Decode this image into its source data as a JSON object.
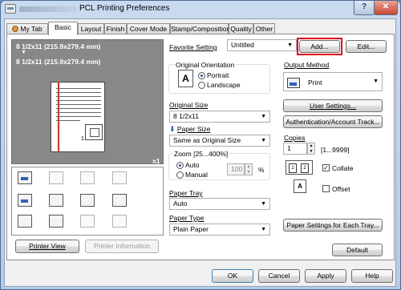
{
  "window": {
    "title": "PCL Printing Preferences",
    "help_btn": "?",
    "close_btn": "✕"
  },
  "tabs": [
    "My Tab",
    "Basic",
    "Layout",
    "Finish",
    "Cover Mode",
    "Stamp/Composition",
    "Quality",
    "Other"
  ],
  "favorite": {
    "label": "Favorite Setting",
    "value": "Untitled",
    "add": "Add...",
    "edit": "Edit..."
  },
  "preview": {
    "line1": "8 1/2x11 (215.9x279.4 mm)",
    "arrow": "▼",
    "line2": "8 1/2x11 (215.9x279.4 mm)",
    "zoom": "x1",
    "page_number": "1",
    "printer_view": "Printer View",
    "printer_info": "Printer Information"
  },
  "orientation": {
    "label": "Original Orientation",
    "icon_letter": "A",
    "portrait": "Portrait",
    "landscape": "Landscape",
    "selected": "Portrait"
  },
  "original_size": {
    "label": "Original Size",
    "value": "8 1/2x11"
  },
  "paper_size": {
    "label": "Paper Size",
    "value": "Same as Original Size"
  },
  "zoom": {
    "label": "Zoom [25...400%]",
    "auto": "Auto",
    "manual": "Manual",
    "value": "100",
    "unit": "%"
  },
  "paper_tray": {
    "label": "Paper Tray",
    "value": "Auto"
  },
  "paper_type": {
    "label": "Paper Type",
    "value": "Plain Paper"
  },
  "output": {
    "label": "Output Method",
    "value": "Print",
    "user_settings": "User Settings...",
    "auth": "Authentication/Account Track..."
  },
  "copies": {
    "label": "Copies",
    "value": "1",
    "range": "[1...9999]",
    "collate": "Collate",
    "offset": "Offset",
    "collate_checked": true,
    "offset_checked": false
  },
  "buttons": {
    "paper_settings": "Paper Settings for Each Tray...",
    "default": "Default",
    "ok": "OK",
    "cancel": "Cancel",
    "apply": "Apply",
    "help": "Help"
  }
}
